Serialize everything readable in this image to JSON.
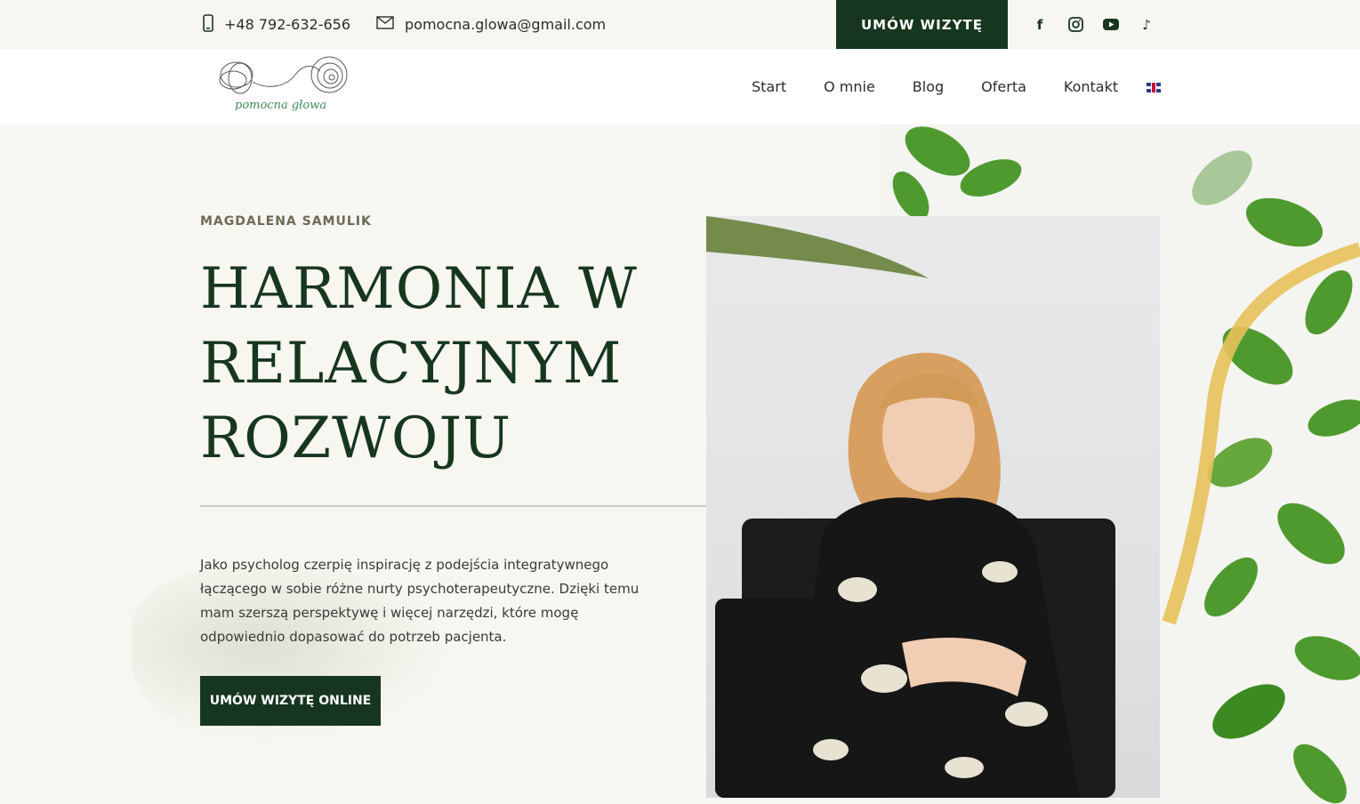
{
  "topbar": {
    "phone": "+48 792-632-656",
    "email": "pomocna.glowa@gmail.com",
    "cta": "UMÓW WIZYTĘ",
    "socials": [
      {
        "name": "facebook-icon",
        "glyph": "f"
      },
      {
        "name": "instagram-icon",
        "glyph": ""
      },
      {
        "name": "youtube-icon",
        "glyph": ""
      },
      {
        "name": "tiktok-icon",
        "glyph": "♪"
      }
    ]
  },
  "header": {
    "logo_text": "pomocna głowa",
    "nav": [
      "Start",
      "O mnie",
      "Blog",
      "Oferta",
      "Kontakt"
    ],
    "language_flag": "english-flag-icon"
  },
  "hero": {
    "kicker": "MAGDALENA SAMULIK",
    "headline_lines": [
      "HARMONIA W",
      "RELACYJNYM",
      "ROZWOJU"
    ],
    "lead": "Jako psycholog czerpię inspirację z podejścia integratywnego łączącego w sobie różne nurty psychoterapeutyczne. Dzięki temu mam szerszą perspektywę i więcej narzędzi, które mogę odpowiednio dopasować do potrzeb pacjenta.",
    "cta": "UMÓW WIZYTĘ ONLINE"
  },
  "colors": {
    "brand_dark_green": "#17361f",
    "background": "#f8f6f1",
    "leaf_green": "#4f9a2e",
    "ribbon": "#e8c15a"
  }
}
